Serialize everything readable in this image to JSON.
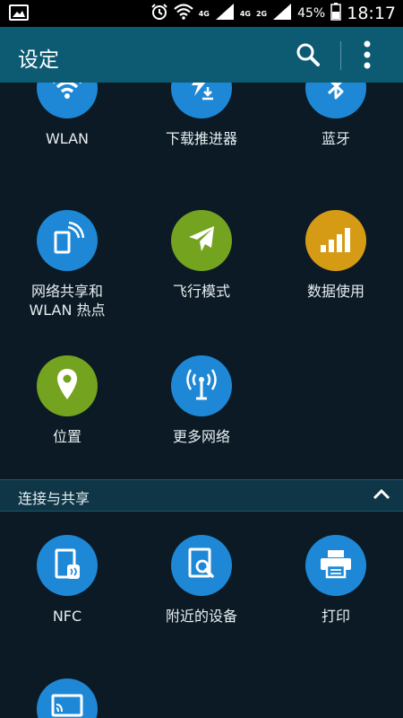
{
  "status_bar": {
    "time": "18:17",
    "battery_percent": "45%",
    "network_labels": [
      "4G",
      "4G",
      "2G"
    ],
    "icons": [
      "image-icon",
      "alarm-icon",
      "wifi-icon",
      "signal-icon",
      "battery-icon"
    ]
  },
  "action_bar": {
    "title": "设定",
    "icons": [
      "search-icon",
      "more-vert-icon"
    ]
  },
  "network_grid": [
    {
      "label": "WLAN",
      "icon": "wifi-icon",
      "color": "#1e88d6"
    },
    {
      "label": "下载推进器",
      "icon": "download-booster-icon",
      "color": "#1e88d6"
    },
    {
      "label": "蓝牙",
      "icon": "bluetooth-icon",
      "color": "#1e88d6"
    },
    {
      "label": "网络共享和\nWLAN 热点",
      "icon": "hotspot-icon",
      "color": "#1e88d6"
    },
    {
      "label": "飞行模式",
      "icon": "airplane-icon",
      "color": "#74a320"
    },
    {
      "label": "数据使用",
      "icon": "data-usage-icon",
      "color": "#d69b15"
    },
    {
      "label": "位置",
      "icon": "location-icon",
      "color": "#74a320"
    },
    {
      "label": "更多网络",
      "icon": "more-networks-icon",
      "color": "#1e88d6"
    }
  ],
  "section": {
    "title": "连接与共享",
    "icon": "chevron-up-icon"
  },
  "share_grid": [
    {
      "label": "NFC",
      "icon": "nfc-icon",
      "color": "#1e88d6"
    },
    {
      "label": "附近的设备",
      "icon": "nearby-devices-icon",
      "color": "#1e88d6"
    },
    {
      "label": "打印",
      "icon": "print-icon",
      "color": "#1e88d6"
    },
    {
      "label": "",
      "icon": "screen-mirroring-icon",
      "color": "#1e88d6"
    }
  ]
}
